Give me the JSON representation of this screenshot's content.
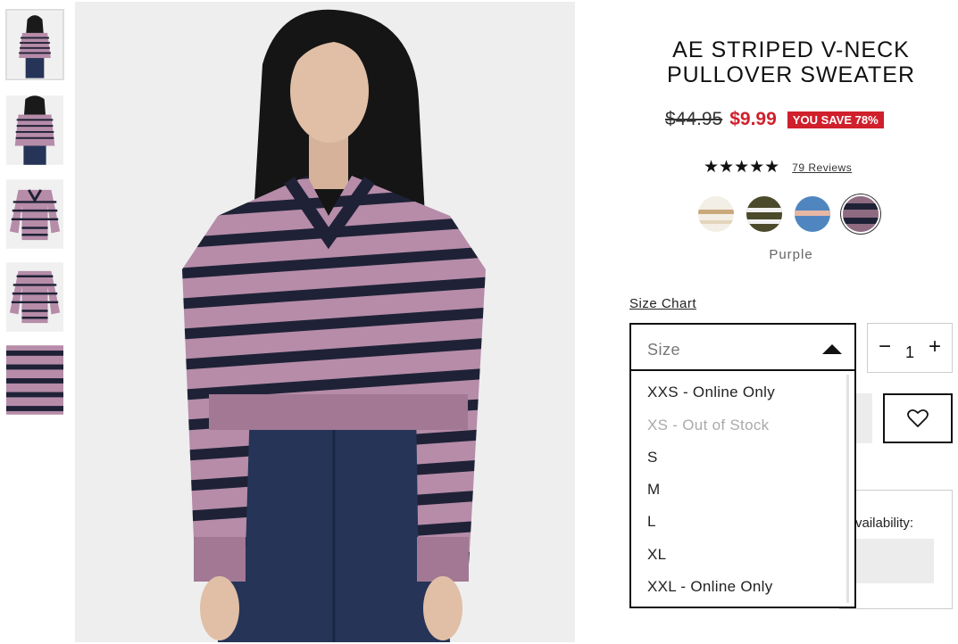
{
  "product": {
    "title_line1": "AE STRIPED V-NECK",
    "title_line2": "PULLOVER SWEATER",
    "old_price": "$44.95",
    "sale_price": "$9.99",
    "save_badge": "YOU SAVE 78%",
    "stars": "★★★★★",
    "rating_value": 5,
    "reviews_label": "79 Reviews",
    "selected_color": "Purple"
  },
  "colors": {
    "stripe_dark": "#1f2236",
    "stripe_light": "#b68ca9",
    "sale_red": "#d0202c"
  },
  "swatches": [
    {
      "name": "cream-swatch"
    },
    {
      "name": "olive-swatch"
    },
    {
      "name": "blue-swatch"
    },
    {
      "name": "purple-swatch",
      "selected": true
    }
  ],
  "size": {
    "chart_link": "Size Chart",
    "placeholder": "Size",
    "options": [
      {
        "label": "XXS - Online Only",
        "available": true
      },
      {
        "label": "XS - Out of Stock",
        "available": false
      },
      {
        "label": "S",
        "available": true
      },
      {
        "label": "M",
        "available": true
      },
      {
        "label": "L",
        "available": true
      },
      {
        "label": "XL",
        "available": true
      },
      {
        "label": "XXL - Online Only",
        "available": true
      }
    ]
  },
  "quantity": {
    "minus": "−",
    "value": "1",
    "plus": "+"
  },
  "availability": {
    "label": "vailability:"
  },
  "icons": {
    "wishlist": "heart-icon",
    "dropdown": "caret-up-icon"
  }
}
